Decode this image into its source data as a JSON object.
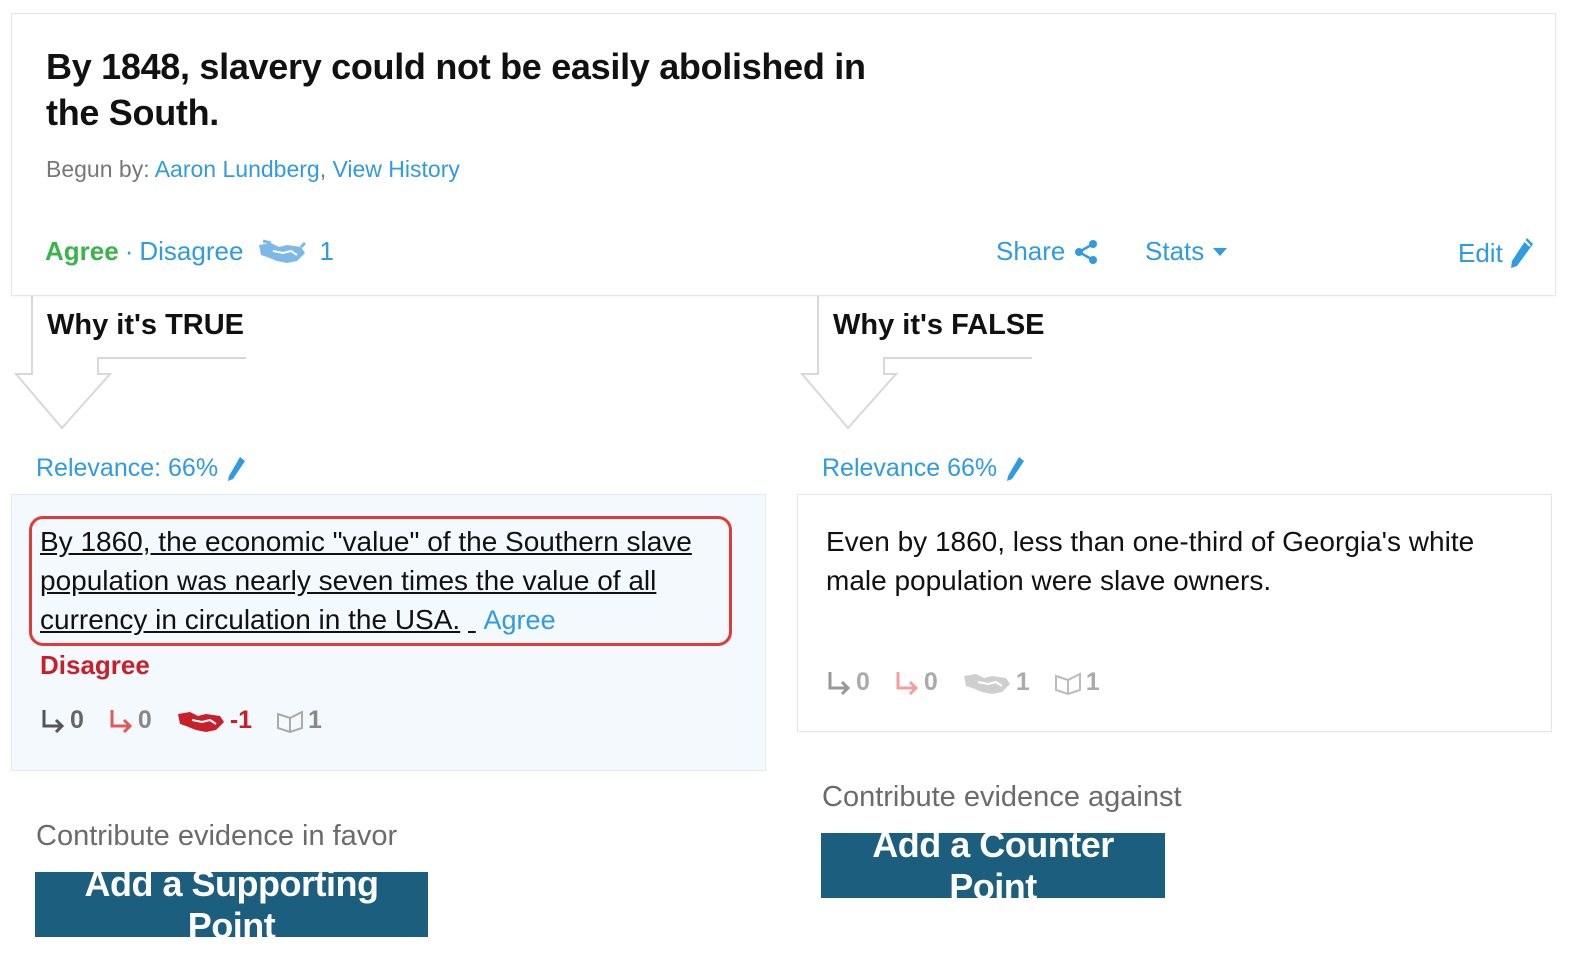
{
  "claim": {
    "title": "By 1848, slavery could not be easily abolished in the South.",
    "begun_by_label": "Begun by:",
    "author": "Aaron Lundberg",
    "view_history": "View History",
    "agree": "Agree",
    "separator": "·",
    "disagree": "Disagree",
    "vote_count": "1",
    "share": "Share",
    "stats": "Stats",
    "edit": "Edit"
  },
  "columns": {
    "true": {
      "heading": "Why it's TRUE",
      "relevance": "Relevance: 66%",
      "evidence": {
        "text": "By 1860, the economic \"value\" of the Southern slave population was nearly seven times the value of all currency in circulation in the USA.",
        "agree": "Agree",
        "disagree": "Disagree",
        "stats": {
          "supporting": "0",
          "counter": "0",
          "votes": "-1",
          "sources": "1"
        }
      },
      "contribute_label": "Contribute evidence in favor",
      "button": "Add a Supporting Point"
    },
    "false": {
      "heading": "Why it's FALSE",
      "relevance": "Relevance 66%",
      "evidence": {
        "text": "Even by 1860, less than one-third of Georgia's white male population were slave owners.",
        "stats": {
          "supporting": "0",
          "counter": "0",
          "votes": "1",
          "sources": "1"
        }
      },
      "contribute_label": "Contribute evidence against",
      "button": "Add a Counter Point"
    }
  },
  "colors": {
    "link": "#2e9be2",
    "agree": "#3ab54a",
    "disagree": "#c8202a",
    "button": "#1b5e7e",
    "highlight": "#e03a3a"
  }
}
